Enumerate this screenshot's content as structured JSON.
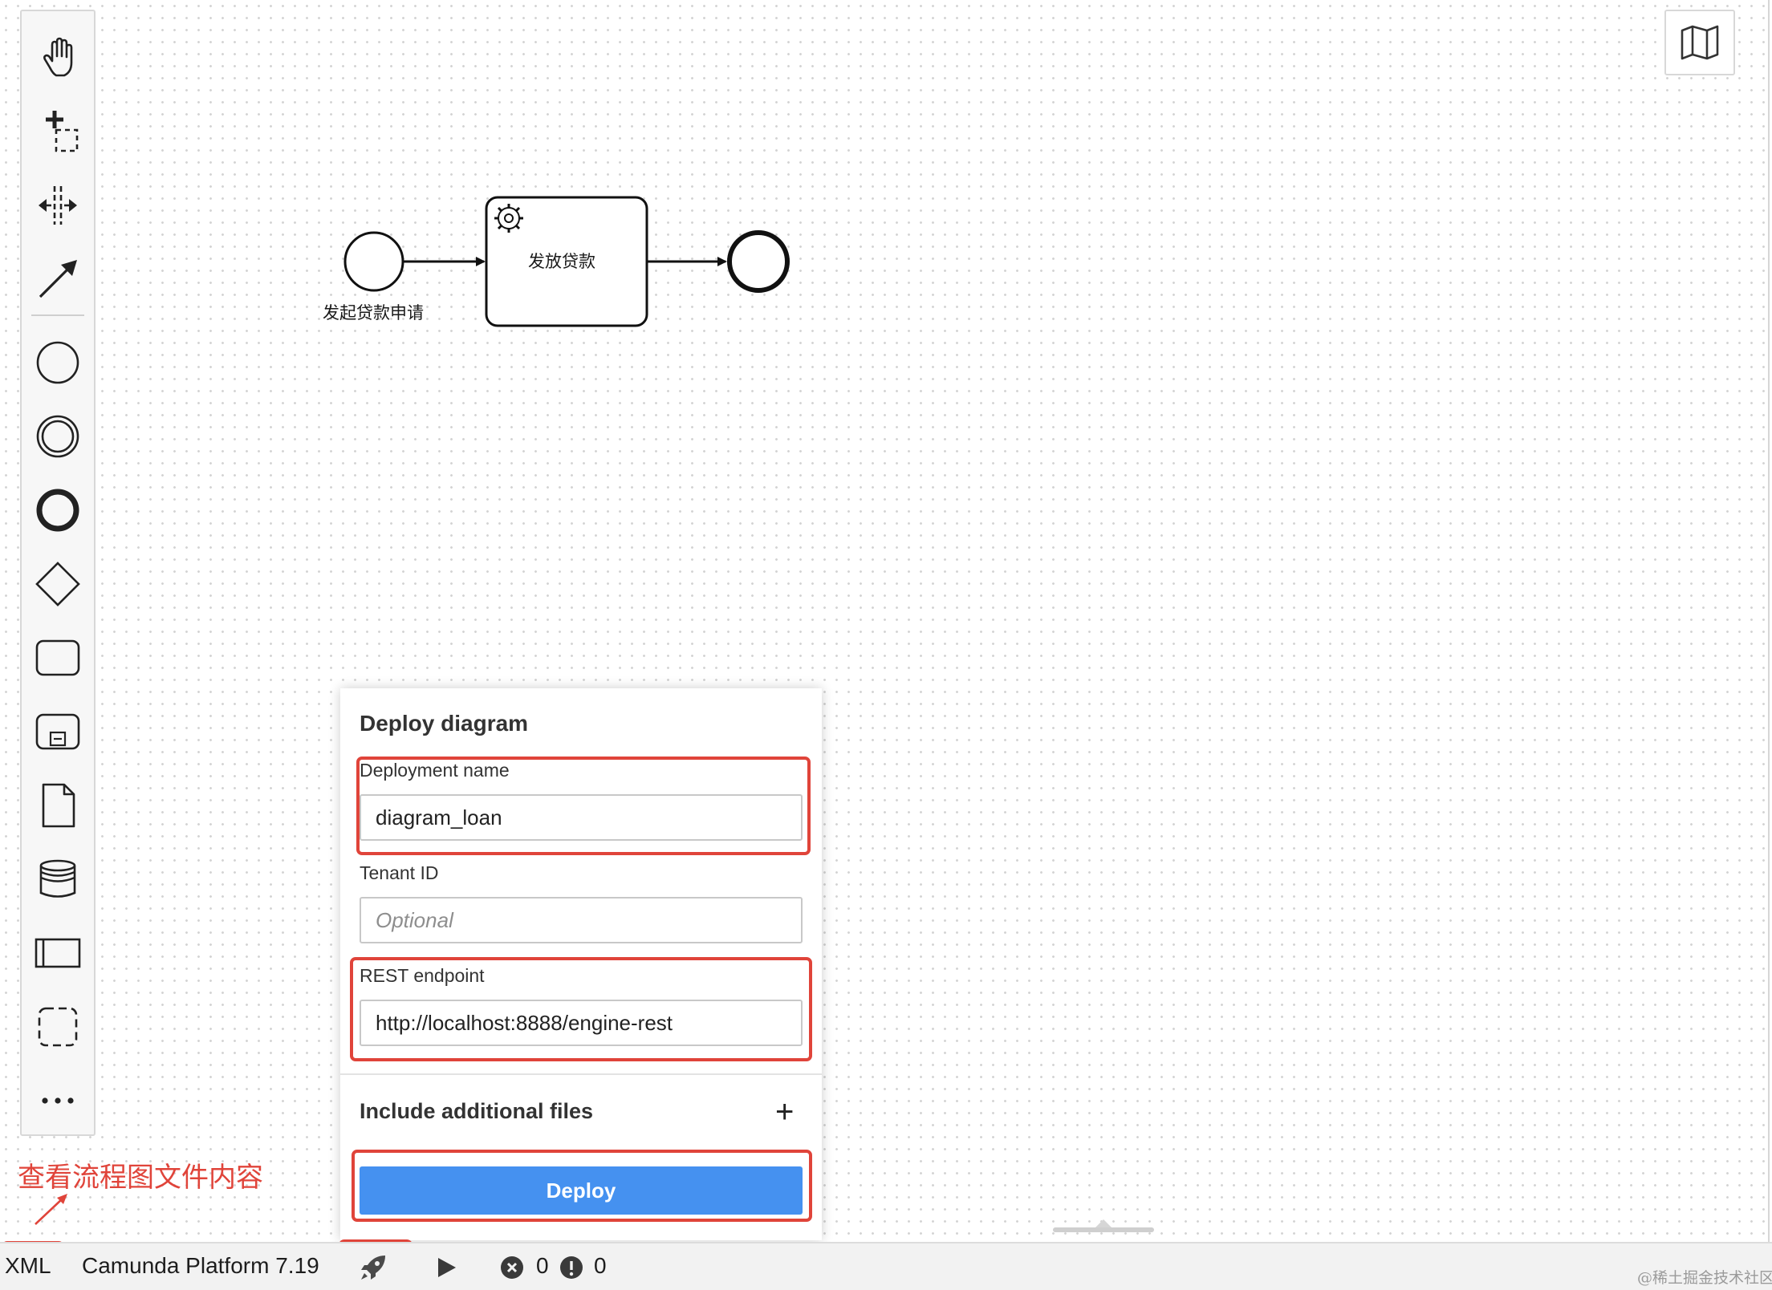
{
  "palette": {
    "tools": [
      {
        "name": "hand-tool",
        "icon": "hand-icon"
      },
      {
        "name": "lasso-tool",
        "icon": "lasso-icon"
      },
      {
        "name": "space-tool",
        "icon": "space-icon"
      },
      {
        "name": "connect-tool",
        "icon": "arrow-icon"
      },
      {
        "name": "start-event",
        "icon": "start-event-icon"
      },
      {
        "name": "intermediate-event",
        "icon": "intermediate-event-icon"
      },
      {
        "name": "end-event",
        "icon": "end-event-icon"
      },
      {
        "name": "gateway",
        "icon": "gateway-icon"
      },
      {
        "name": "task",
        "icon": "task-icon"
      },
      {
        "name": "subprocess",
        "icon": "subprocess-icon"
      },
      {
        "name": "data-object",
        "icon": "data-object-icon"
      },
      {
        "name": "data-store",
        "icon": "data-store-icon"
      },
      {
        "name": "participant",
        "icon": "participant-icon"
      },
      {
        "name": "group",
        "icon": "group-icon"
      },
      {
        "name": "more",
        "icon": "more-icon"
      }
    ]
  },
  "diagram": {
    "start_event_label": "发起贷款申请",
    "service_task_label": "发放贷款"
  },
  "deploy": {
    "title": "Deploy diagram",
    "deployment_name_label": "Deployment name",
    "deployment_name_value": "diagram_loan",
    "tenant_id_label": "Tenant ID",
    "tenant_id_placeholder": "Optional",
    "rest_endpoint_label": "REST endpoint",
    "rest_endpoint_value": "http://localhost:8888/engine-rest",
    "include_files_label": "Include additional files",
    "include_files_plus": "+",
    "deploy_button": "Deploy"
  },
  "annotation": {
    "text": "查看流程图文件内容",
    "color": "#e0443a"
  },
  "statusbar": {
    "xml_label": "XML",
    "platform_label": "Camunda Platform 7.19",
    "error_count": "0",
    "warning_count": "0"
  },
  "watermark": "@稀土掘金技术社区",
  "colors": {
    "primary_button": "#4591f0",
    "highlight": "#e0443a"
  }
}
